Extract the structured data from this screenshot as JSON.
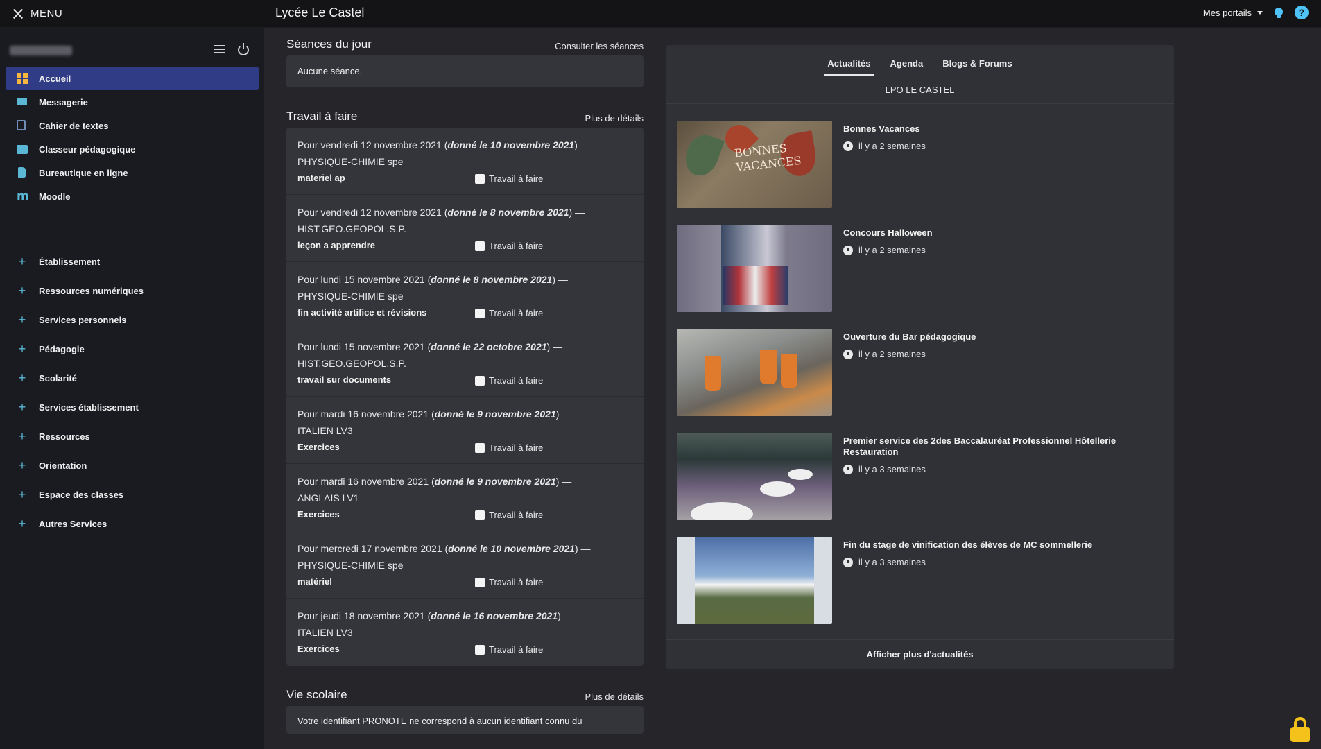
{
  "topbar": {
    "menu_label": "MENU",
    "site_title": "Lycée Le Castel",
    "portals_label": "Mes portails"
  },
  "sidebar": {
    "items": [
      {
        "label": "Accueil",
        "icon": "grid-icon",
        "active": true
      },
      {
        "label": "Messagerie",
        "icon": "mail-icon"
      },
      {
        "label": "Cahier de textes",
        "icon": "notebook-icon"
      },
      {
        "label": "Classeur pédagogique",
        "icon": "folder-icon"
      },
      {
        "label": "Bureautique en ligne",
        "icon": "office-icon"
      },
      {
        "label": "Moodle",
        "icon": "moodle-icon"
      }
    ],
    "groups": [
      "Établissement",
      "Ressources numériques",
      "Services personnels",
      "Pédagogie",
      "Scolarité",
      "Services établissement",
      "Ressources",
      "Orientation",
      "Espace des classes",
      "Autres Services"
    ]
  },
  "seances": {
    "title": "Séances du jour",
    "link": "Consulter les séances",
    "empty": "Aucune séance."
  },
  "travail": {
    "title": "Travail à faire",
    "link": "Plus de détails",
    "check_label": "Travail à faire",
    "items": [
      {
        "prefix": "Pour vendredi 12 novembre 2021 (",
        "given": "donné le 10 novembre 2021",
        "suffix": ") —",
        "subject": "PHYSIQUE-CHIMIE spe",
        "task": "materiel ap"
      },
      {
        "prefix": "Pour vendredi 12 novembre 2021 (",
        "given": "donné le 8 novembre 2021",
        "suffix": ") —",
        "subject": "HIST.GEO.GEOPOL.S.P.",
        "task": "leçon a apprendre"
      },
      {
        "prefix": "Pour lundi 15 novembre 2021 (",
        "given": "donné le 8 novembre 2021",
        "suffix": ") —",
        "subject": "PHYSIQUE-CHIMIE spe",
        "task": "fin activité artifice et révisions"
      },
      {
        "prefix": "Pour lundi 15 novembre 2021 (",
        "given": "donné le 22 octobre 2021",
        "suffix": ") —",
        "subject": "HIST.GEO.GEOPOL.S.P.",
        "task": "travail sur documents"
      },
      {
        "prefix": "Pour mardi 16 novembre 2021 (",
        "given": "donné le 9 novembre 2021",
        "suffix": ") —",
        "subject": "ITALIEN LV3",
        "task": "Exercices"
      },
      {
        "prefix": "Pour mardi 16 novembre 2021 (",
        "given": "donné le 9 novembre 2021",
        "suffix": ") —",
        "subject": "ANGLAIS LV1",
        "task": "Exercices"
      },
      {
        "prefix": "Pour mercredi 17 novembre 2021 (",
        "given": "donné le 10 novembre 2021",
        "suffix": ") —",
        "subject": "PHYSIQUE-CHIMIE spe",
        "task": "matériel"
      },
      {
        "prefix": "Pour jeudi 18 novembre 2021 (",
        "given": "donné le 16 novembre 2021",
        "suffix": ") —",
        "subject": "ITALIEN LV3",
        "task": "Exercices"
      }
    ]
  },
  "vie": {
    "title": "Vie scolaire",
    "link": "Plus de détails",
    "text": "Votre identifiant PRONOTE ne correspond à aucun identifiant connu du"
  },
  "news": {
    "tabs": [
      "Actualités",
      "Agenda",
      "Blogs & Forums"
    ],
    "active_tab": 0,
    "org": "LPO LE CASTEL",
    "items": [
      {
        "title": "Bonnes Vacances",
        "date": "il y a 2 semaines"
      },
      {
        "title": "Concours Halloween",
        "date": "il y a 2 semaines"
      },
      {
        "title": "Ouverture du Bar pédagogique",
        "date": "il y a 2 semaines"
      },
      {
        "title": "Premier service des 2des Baccalauréat Professionnel Hôtellerie Restauration",
        "date": "il y a 3 semaines"
      },
      {
        "title": "Fin du stage de vinification des élèves de MC sommellerie",
        "date": "il y a 3 semaines"
      }
    ],
    "thumb1_text": "BONNES VACANCES",
    "more": "Afficher plus d'actualités"
  },
  "colors": {
    "accent": "#303c86",
    "icon_blue": "#5ab8d6",
    "home_icon": "#f6b73c",
    "lock": "#f4c21a"
  }
}
